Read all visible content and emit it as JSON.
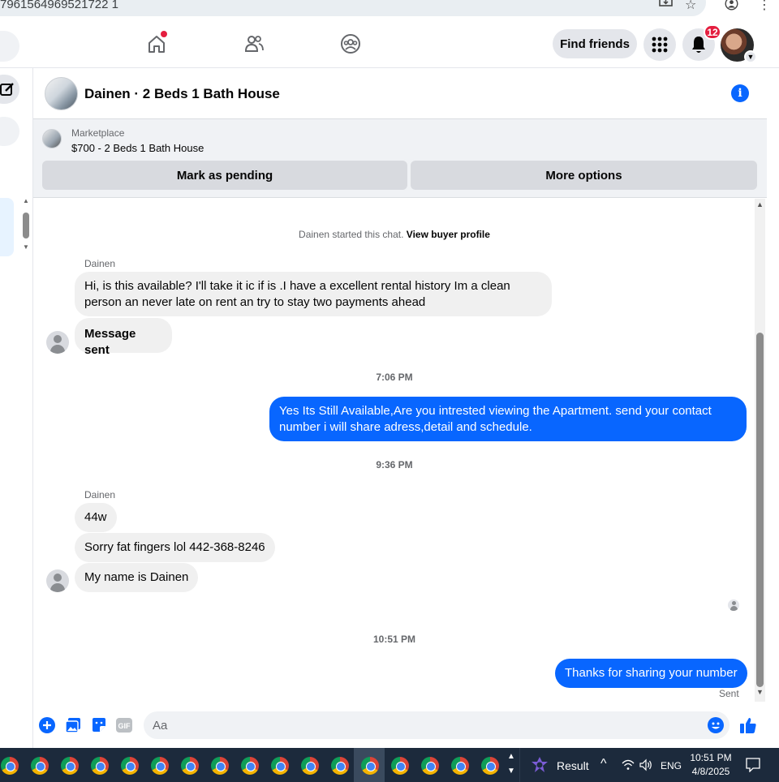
{
  "browser": {
    "url_fragment": "7961564969521722 1",
    "icons": [
      "install-app-icon",
      "bookmark-star-icon",
      "profile-icon",
      "menu-dots-icon"
    ]
  },
  "topnav": {
    "icons": [
      "home-icon",
      "friends-icon",
      "groups-icon"
    ],
    "find_friends": "Find friends",
    "notifications_count": "12",
    "brand_blue": "#0866ff",
    "alert_red": "#e41e3f"
  },
  "chat": {
    "title": "Dainen · 2 Beds 1 Bath House",
    "marketplace": {
      "label": "Marketplace",
      "price_line": "$700 - 2 Beds 1 Bath House",
      "mark_pending": "Mark as pending",
      "more_options": "More options"
    },
    "system": {
      "started": "Dainen started this chat.",
      "view_profile": "View buyer profile"
    },
    "messages": [
      {
        "sender": "Dainen",
        "text": "Hi, is this available? I'll take it ic if is .I have a excellent rental history Im  a  clean person an never late  on rent an try to stay two payments ahead"
      },
      {
        "text": "Message sent"
      },
      {
        "timestamp": "7:06 PM"
      },
      {
        "outgoing": true,
        "text": "Yes Its Still Available,Are you intrested viewing the Apartment. send your contact number i will share adress,detail and schedule."
      },
      {
        "timestamp": "9:36 PM"
      },
      {
        "sender": "Dainen",
        "text": "44w"
      },
      {
        "text": "Sorry fat fingers lol 442-368-8246"
      },
      {
        "text": "My name is Dainen"
      },
      {
        "timestamp": "10:51 PM"
      },
      {
        "outgoing": true,
        "text": "Thanks for sharing your number"
      }
    ],
    "sent_status": "Sent",
    "composer_placeholder": "Aa"
  },
  "taskbar": {
    "result_label": "Result",
    "language": "ENG",
    "time": "10:51 PM",
    "date": "4/8/2025"
  }
}
